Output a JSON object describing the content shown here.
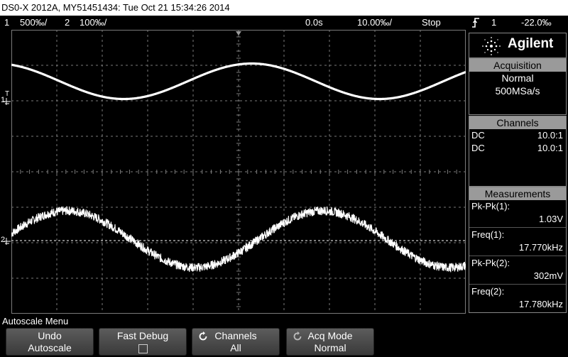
{
  "title": "DS0-X 2012A, MY51451434: Tue Oct 21 15:34:26 2014",
  "status": {
    "ch1_num": "1",
    "ch1_scale": "500‰/",
    "ch2_num": "2",
    "ch2_scale": "100‰/",
    "time_delay": "0.0s",
    "time_scale": "10.00‰/",
    "run_state": "Stop",
    "trigger_icon": "rising-edge-trigger-icon",
    "trigger_source": "1",
    "trigger_level": "-22.0‰"
  },
  "markers": {
    "ch1": "1",
    "ch2": "2",
    "trigger_level": "T"
  },
  "brand": {
    "name": "Agilent",
    "logo_icon": "agilent-spark-icon"
  },
  "acquisition": {
    "header": "Acquisition",
    "mode": "Normal",
    "rate": "500MSa/s"
  },
  "channels": {
    "header": "Channels",
    "rows": [
      {
        "coupling": "DC",
        "probe": "10.0:1"
      },
      {
        "coupling": "DC",
        "probe": "10.0:1"
      }
    ]
  },
  "measurements": {
    "header": "Measurements",
    "items": [
      {
        "label": "Pk-Pk(1):",
        "value": "1.03V"
      },
      {
        "label": "Freq(1):",
        "value": "17.770kHz"
      },
      {
        "label": "Pk-Pk(2):",
        "value": "302mV"
      },
      {
        "label": "Freq(2):",
        "value": "17.780kHz"
      }
    ]
  },
  "softmenu": {
    "title": "Autoscale Menu",
    "keys": [
      {
        "top": "Undo",
        "bottom": "Autoscale"
      },
      {
        "top": "Fast Debug",
        "bottom": ""
      },
      {
        "top": "Channels",
        "bottom": "All"
      },
      {
        "top": "Acq Mode",
        "bottom": "Normal"
      }
    ]
  },
  "colors": {
    "trace": "#ffffff",
    "grid": "#7a7a7a",
    "panel_header": "#9a9a9a",
    "softkey": "#4a4a4a"
  },
  "waveforms": {
    "x_units": "divisions (0-10)",
    "y_units": "divisions from center (+ up)",
    "ch1": {
      "type": "sine",
      "cycles_on_screen": 1.777,
      "pk_pk_div": 1.0,
      "offset_div": 2.55
    },
    "ch2": {
      "type": "sine",
      "cycles_on_screen": 1.778,
      "pk_pk_div": 1.6,
      "offset_div": -1.9,
      "noise_div": 0.12
    }
  }
}
